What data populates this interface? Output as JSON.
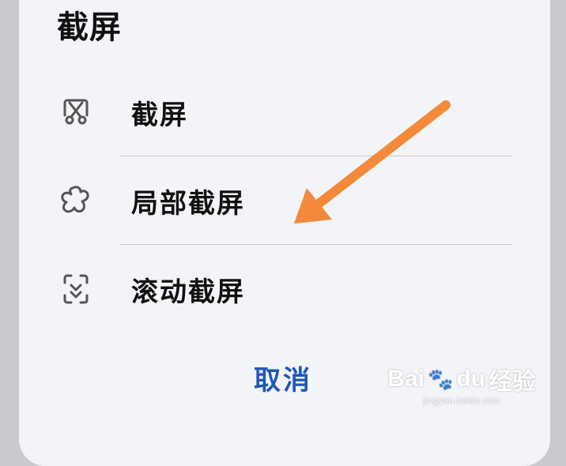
{
  "dialog": {
    "title": "截屏",
    "items": [
      {
        "label": "截屏",
        "icon": "screenshot-scissors-icon"
      },
      {
        "label": "局部截屏",
        "icon": "partial-screenshot-icon"
      },
      {
        "label": "滚动截屏",
        "icon": "scroll-screenshot-icon"
      }
    ],
    "cancel_label": "取消"
  },
  "colors": {
    "accent": "#1e57b8",
    "arrow": "#f28a3a",
    "background": "#f2f4f7"
  },
  "watermark": {
    "brand_left": "Bai",
    "brand_mid": "du",
    "brand_right": "经验",
    "url": "jingyan.baidu.com"
  }
}
